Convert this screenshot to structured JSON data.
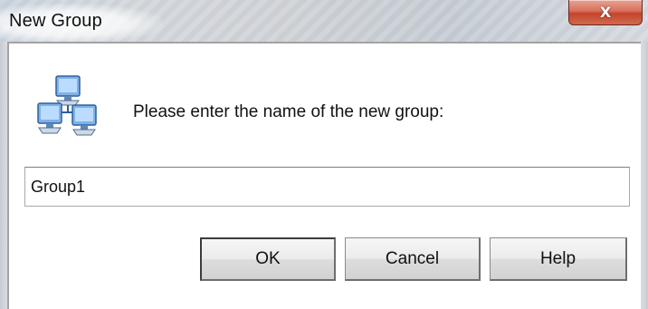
{
  "window": {
    "title": "New Group",
    "close_glyph": "X"
  },
  "icon": {
    "name": "network-group-icon",
    "accent": "#3a8ee6"
  },
  "dialog": {
    "prompt": "Please enter the name of the new group:",
    "group_name_value": "Group1"
  },
  "buttons": {
    "ok_label": "OK",
    "cancel_label": "Cancel",
    "help_label": "Help"
  },
  "colors": {
    "close_button": "#c4442b",
    "titlebar": "#cfd2d6"
  }
}
